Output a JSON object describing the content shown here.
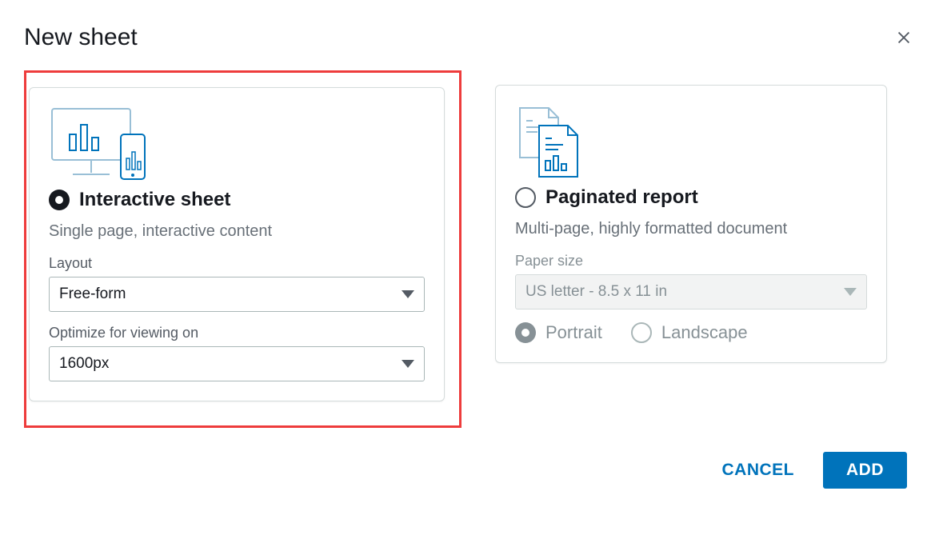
{
  "dialog": {
    "title": "New sheet"
  },
  "interactive": {
    "title": "Interactive sheet",
    "desc": "Single page, interactive content",
    "layout_label": "Layout",
    "layout_value": "Free-form",
    "optimize_label": "Optimize for viewing on",
    "optimize_value": "1600px"
  },
  "paginated": {
    "title": "Paginated report",
    "desc": "Multi-page, highly formatted document",
    "paper_label": "Paper size",
    "paper_value": "US letter - 8.5 x 11 in",
    "portrait": "Portrait",
    "landscape": "Landscape"
  },
  "footer": {
    "cancel": "CANCEL",
    "add": "ADD"
  }
}
